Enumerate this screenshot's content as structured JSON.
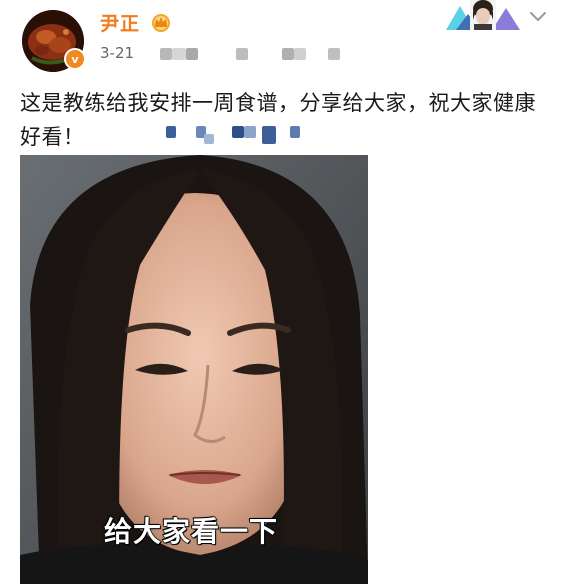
{
  "post": {
    "username": "尹正",
    "time": "3-21",
    "text": "这是教练给我安排一周食谱，分享给大家，祝大家健康好看！",
    "verified_badge_label": "v"
  },
  "video": {
    "caption": "给大家看一下"
  },
  "icons": {
    "avatar": "avatar-food-image",
    "vip": "crown-icon",
    "verified": "verified-badge-icon",
    "menu": "chevron-down-icon",
    "profile_thumb": "profile-thumbnail-icon"
  },
  "colors": {
    "username": "#f27a1a",
    "badge": "#f08a1e",
    "text": "#1a1a1a",
    "time": "#666666"
  }
}
